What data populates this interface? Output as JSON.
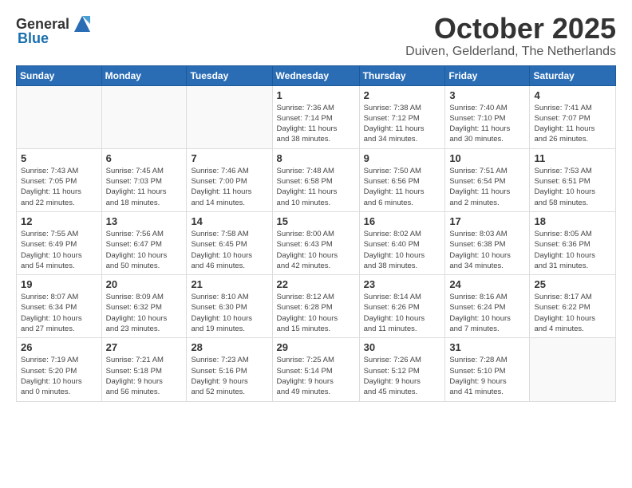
{
  "header": {
    "logo_general": "General",
    "logo_blue": "Blue",
    "month": "October 2025",
    "location": "Duiven, Gelderland, The Netherlands"
  },
  "weekdays": [
    "Sunday",
    "Monday",
    "Tuesday",
    "Wednesday",
    "Thursday",
    "Friday",
    "Saturday"
  ],
  "weeks": [
    [
      {
        "day": "",
        "info": ""
      },
      {
        "day": "",
        "info": ""
      },
      {
        "day": "",
        "info": ""
      },
      {
        "day": "1",
        "info": "Sunrise: 7:36 AM\nSunset: 7:14 PM\nDaylight: 11 hours\nand 38 minutes."
      },
      {
        "day": "2",
        "info": "Sunrise: 7:38 AM\nSunset: 7:12 PM\nDaylight: 11 hours\nand 34 minutes."
      },
      {
        "day": "3",
        "info": "Sunrise: 7:40 AM\nSunset: 7:10 PM\nDaylight: 11 hours\nand 30 minutes."
      },
      {
        "day": "4",
        "info": "Sunrise: 7:41 AM\nSunset: 7:07 PM\nDaylight: 11 hours\nand 26 minutes."
      }
    ],
    [
      {
        "day": "5",
        "info": "Sunrise: 7:43 AM\nSunset: 7:05 PM\nDaylight: 11 hours\nand 22 minutes."
      },
      {
        "day": "6",
        "info": "Sunrise: 7:45 AM\nSunset: 7:03 PM\nDaylight: 11 hours\nand 18 minutes."
      },
      {
        "day": "7",
        "info": "Sunrise: 7:46 AM\nSunset: 7:00 PM\nDaylight: 11 hours\nand 14 minutes."
      },
      {
        "day": "8",
        "info": "Sunrise: 7:48 AM\nSunset: 6:58 PM\nDaylight: 11 hours\nand 10 minutes."
      },
      {
        "day": "9",
        "info": "Sunrise: 7:50 AM\nSunset: 6:56 PM\nDaylight: 11 hours\nand 6 minutes."
      },
      {
        "day": "10",
        "info": "Sunrise: 7:51 AM\nSunset: 6:54 PM\nDaylight: 11 hours\nand 2 minutes."
      },
      {
        "day": "11",
        "info": "Sunrise: 7:53 AM\nSunset: 6:51 PM\nDaylight: 10 hours\nand 58 minutes."
      }
    ],
    [
      {
        "day": "12",
        "info": "Sunrise: 7:55 AM\nSunset: 6:49 PM\nDaylight: 10 hours\nand 54 minutes."
      },
      {
        "day": "13",
        "info": "Sunrise: 7:56 AM\nSunset: 6:47 PM\nDaylight: 10 hours\nand 50 minutes."
      },
      {
        "day": "14",
        "info": "Sunrise: 7:58 AM\nSunset: 6:45 PM\nDaylight: 10 hours\nand 46 minutes."
      },
      {
        "day": "15",
        "info": "Sunrise: 8:00 AM\nSunset: 6:43 PM\nDaylight: 10 hours\nand 42 minutes."
      },
      {
        "day": "16",
        "info": "Sunrise: 8:02 AM\nSunset: 6:40 PM\nDaylight: 10 hours\nand 38 minutes."
      },
      {
        "day": "17",
        "info": "Sunrise: 8:03 AM\nSunset: 6:38 PM\nDaylight: 10 hours\nand 34 minutes."
      },
      {
        "day": "18",
        "info": "Sunrise: 8:05 AM\nSunset: 6:36 PM\nDaylight: 10 hours\nand 31 minutes."
      }
    ],
    [
      {
        "day": "19",
        "info": "Sunrise: 8:07 AM\nSunset: 6:34 PM\nDaylight: 10 hours\nand 27 minutes."
      },
      {
        "day": "20",
        "info": "Sunrise: 8:09 AM\nSunset: 6:32 PM\nDaylight: 10 hours\nand 23 minutes."
      },
      {
        "day": "21",
        "info": "Sunrise: 8:10 AM\nSunset: 6:30 PM\nDaylight: 10 hours\nand 19 minutes."
      },
      {
        "day": "22",
        "info": "Sunrise: 8:12 AM\nSunset: 6:28 PM\nDaylight: 10 hours\nand 15 minutes."
      },
      {
        "day": "23",
        "info": "Sunrise: 8:14 AM\nSunset: 6:26 PM\nDaylight: 10 hours\nand 11 minutes."
      },
      {
        "day": "24",
        "info": "Sunrise: 8:16 AM\nSunset: 6:24 PM\nDaylight: 10 hours\nand 7 minutes."
      },
      {
        "day": "25",
        "info": "Sunrise: 8:17 AM\nSunset: 6:22 PM\nDaylight: 10 hours\nand 4 minutes."
      }
    ],
    [
      {
        "day": "26",
        "info": "Sunrise: 7:19 AM\nSunset: 5:20 PM\nDaylight: 10 hours\nand 0 minutes."
      },
      {
        "day": "27",
        "info": "Sunrise: 7:21 AM\nSunset: 5:18 PM\nDaylight: 9 hours\nand 56 minutes."
      },
      {
        "day": "28",
        "info": "Sunrise: 7:23 AM\nSunset: 5:16 PM\nDaylight: 9 hours\nand 52 minutes."
      },
      {
        "day": "29",
        "info": "Sunrise: 7:25 AM\nSunset: 5:14 PM\nDaylight: 9 hours\nand 49 minutes."
      },
      {
        "day": "30",
        "info": "Sunrise: 7:26 AM\nSunset: 5:12 PM\nDaylight: 9 hours\nand 45 minutes."
      },
      {
        "day": "31",
        "info": "Sunrise: 7:28 AM\nSunset: 5:10 PM\nDaylight: 9 hours\nand 41 minutes."
      },
      {
        "day": "",
        "info": ""
      }
    ]
  ]
}
